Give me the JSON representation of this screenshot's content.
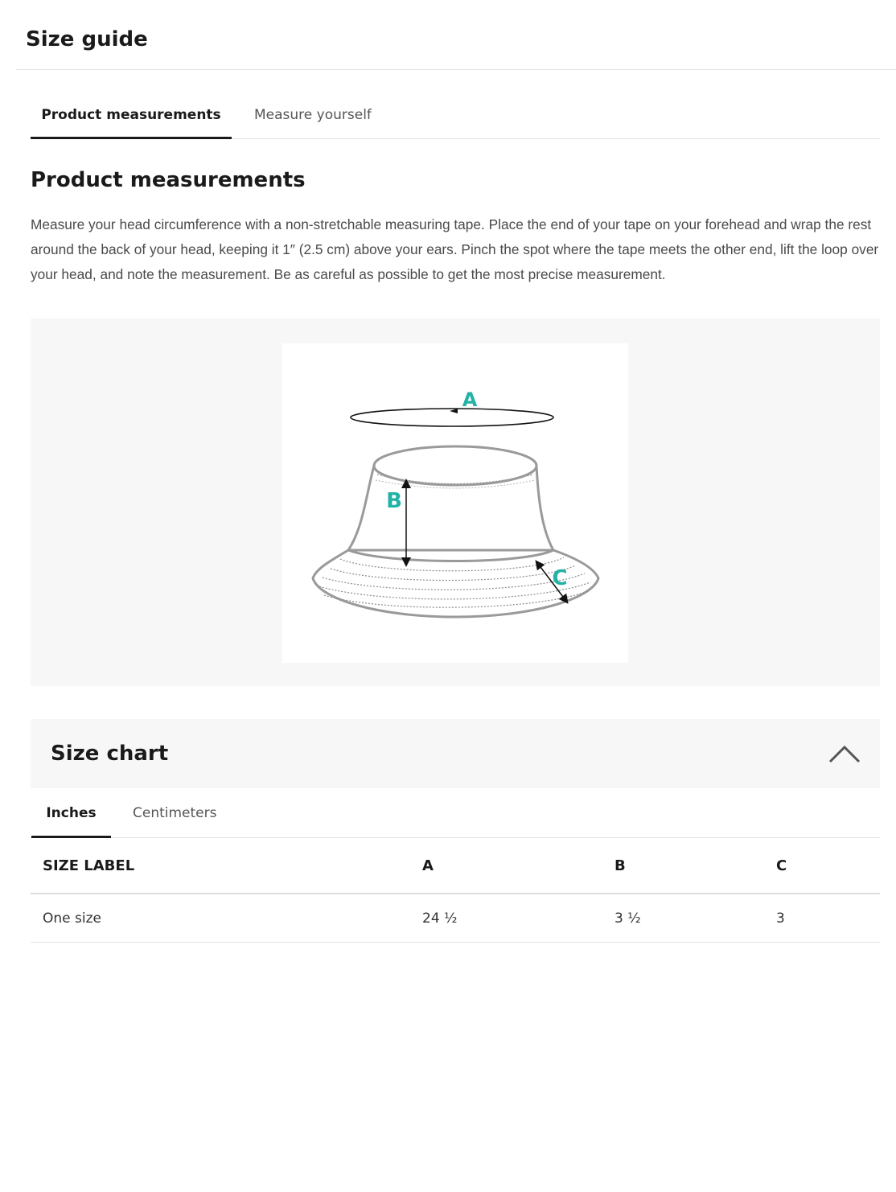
{
  "header": {
    "title": "Size guide"
  },
  "tabs": [
    {
      "label": "Product measurements",
      "active": true
    },
    {
      "label": "Measure yourself",
      "active": false
    }
  ],
  "product": {
    "title": "Product measurements",
    "description": "Measure your head circumference with a non-stretchable measuring tape. Place the end of your  tape on your forehead and wrap the rest around the back of your head, keeping it 1″ (2.5 cm) above your ears. Pinch the spot where the tape meets the other end, lift the loop over your head, and note the measurement. Be as careful as possible to get the most precise measurement."
  },
  "diagram": {
    "labels": {
      "a": "A",
      "b": "B",
      "c": "C"
    },
    "colors": {
      "label": "#22b3a6",
      "outline": "#9a9a9a",
      "arrow": "#111111",
      "panel_bg": "#f7f7f7"
    }
  },
  "size_chart": {
    "title": "Size chart",
    "collapse_icon": "chevron-up-icon",
    "expanded": true,
    "unit_tabs": [
      {
        "label": "Inches",
        "active": true
      },
      {
        "label": "Centimeters",
        "active": false
      }
    ],
    "columns": [
      "SIZE LABEL",
      "A",
      "B",
      "C"
    ],
    "rows": [
      [
        "One size",
        "24 ½",
        "3 ½",
        "3"
      ]
    ]
  }
}
